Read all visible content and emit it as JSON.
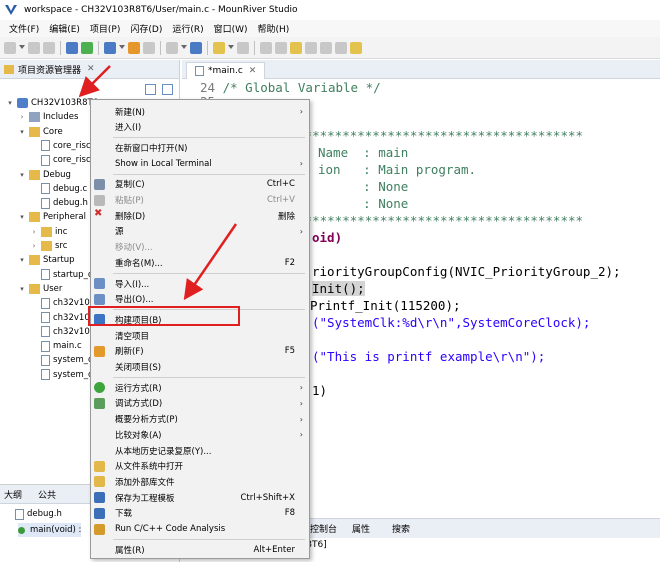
{
  "window": {
    "title": "workspace - CH32V103R8T6/User/main.c - MounRiver Studio"
  },
  "menubar": [
    "文件(F)",
    "编辑(E)",
    "项目(P)",
    "闪存(D)",
    "运行(R)",
    "窗口(W)",
    "帮助(H)"
  ],
  "explorer": {
    "title": "项目资源管理器",
    "close": "✕",
    "tree": [
      {
        "label": "CH32V103R8T6",
        "level": 0,
        "type": "proj",
        "expanded": true
      },
      {
        "label": "Includes",
        "level": 1,
        "type": "inc",
        "expanded": false
      },
      {
        "label": "Core",
        "level": 1,
        "type": "fold",
        "expanded": true
      },
      {
        "label": "core_risc",
        "level": 2,
        "type": "file"
      },
      {
        "label": "core_risc",
        "level": 2,
        "type": "file"
      },
      {
        "label": "Debug",
        "level": 1,
        "type": "fold",
        "expanded": true
      },
      {
        "label": "debug.c",
        "level": 2,
        "type": "file"
      },
      {
        "label": "debug.h",
        "level": 2,
        "type": "file"
      },
      {
        "label": "Peripheral",
        "level": 1,
        "type": "fold",
        "expanded": true
      },
      {
        "label": "inc",
        "level": 2,
        "type": "fold",
        "expanded": false
      },
      {
        "label": "src",
        "level": 2,
        "type": "fold",
        "expanded": false
      },
      {
        "label": "Startup",
        "level": 1,
        "type": "fold",
        "expanded": true
      },
      {
        "label": "startup_c",
        "level": 2,
        "type": "file"
      },
      {
        "label": "User",
        "level": 1,
        "type": "fold",
        "expanded": true
      },
      {
        "label": "ch32v10",
        "level": 2,
        "type": "file"
      },
      {
        "label": "ch32v10",
        "level": 2,
        "type": "file"
      },
      {
        "label": "ch32v10",
        "level": 2,
        "type": "file"
      },
      {
        "label": "main.c",
        "level": 2,
        "type": "file"
      },
      {
        "label": "system_c",
        "level": 2,
        "type": "file"
      },
      {
        "label": "system_c",
        "level": 2,
        "type": "file"
      }
    ]
  },
  "editor": {
    "tab": "*main.c",
    "tab_close": "✕",
    "lines": [
      {
        "num": "24",
        "text": "/* Global Variable */"
      },
      {
        "num": "25",
        "text": ""
      },
      {
        "num": "",
        "text": "****************************************"
      },
      {
        "num": "",
        "text": "Name  : main"
      },
      {
        "num": "",
        "text": "ion   : Main program."
      },
      {
        "num": "",
        "text": "      : None"
      },
      {
        "num": "",
        "text": "      : None"
      },
      {
        "num": "",
        "text": "****************************************"
      },
      {
        "num": "",
        "text": "oid)"
      },
      {
        "num": "",
        "text": "riorityGroupConfig(NVIC_PriorityGroup_2);"
      },
      {
        "num": "",
        "text": "Init();"
      },
      {
        "num": "",
        "text": "Printf_Init(115200);"
      },
      {
        "num": "",
        "text": "(\"SystemClk:%d\\r\\n\",SystemCoreClock);"
      },
      {
        "num": "",
        "text": "(\"This is printf example\\r\\n\");"
      },
      {
        "num": "",
        "text": "1)"
      }
    ]
  },
  "outline": {
    "tabs": [
      "大纲",
      "公共"
    ],
    "rows": [
      "debug.h",
      "main(void) :"
    ]
  },
  "console": {
    "tabs": [
      "控制台",
      "属性",
      "搜索"
    ],
    "text": "R8T6]"
  },
  "context_menu": [
    {
      "label": "新建(N)",
      "shortcut": "",
      "sub": true,
      "icon": ""
    },
    {
      "label": "进入(I)",
      "shortcut": "",
      "sub": false,
      "icon": ""
    },
    {
      "sep": true
    },
    {
      "label": "在新窗口中打开(N)",
      "shortcut": "",
      "sub": false,
      "icon": ""
    },
    {
      "label": "Show in Local Terminal",
      "shortcut": "",
      "sub": true,
      "icon": ""
    },
    {
      "sep": true
    },
    {
      "label": "复制(C)",
      "shortcut": "Ctrl+C",
      "sub": false,
      "icon": "copy"
    },
    {
      "label": "粘贴(P)",
      "shortcut": "Ctrl+V",
      "sub": false,
      "icon": "paste",
      "disabled": true
    },
    {
      "label": "删除(D)",
      "shortcut": "删除",
      "sub": false,
      "icon": "delete"
    },
    {
      "label": "源",
      "shortcut": "",
      "sub": true,
      "icon": ""
    },
    {
      "label": "移动(V)...",
      "shortcut": "",
      "sub": false,
      "icon": "",
      "disabled": true
    },
    {
      "label": "重命名(M)...",
      "shortcut": "F2",
      "sub": false,
      "icon": ""
    },
    {
      "sep": true
    },
    {
      "label": "导入(I)...",
      "shortcut": "",
      "sub": false,
      "icon": "import"
    },
    {
      "label": "导出(O)...",
      "shortcut": "",
      "sub": false,
      "icon": "export"
    },
    {
      "sep": true
    },
    {
      "label": "构建项目(B)",
      "shortcut": "",
      "sub": false,
      "icon": "build"
    },
    {
      "label": "清空项目",
      "shortcut": "",
      "sub": false,
      "icon": ""
    },
    {
      "label": "刷新(F)",
      "shortcut": "F5",
      "sub": false,
      "icon": "refresh"
    },
    {
      "label": "关闭项目(S)",
      "shortcut": "",
      "sub": false,
      "icon": ""
    },
    {
      "sep": true
    },
    {
      "label": "运行方式(R)",
      "shortcut": "",
      "sub": true,
      "icon": "run"
    },
    {
      "label": "调试方式(D)",
      "shortcut": "",
      "sub": true,
      "icon": "debug"
    },
    {
      "label": "概要分析方式(P)",
      "shortcut": "",
      "sub": true,
      "icon": ""
    },
    {
      "label": "比较对象(A)",
      "shortcut": "",
      "sub": true,
      "icon": ""
    },
    {
      "label": "从本地历史记录复原(Y)...",
      "shortcut": "",
      "sub": false,
      "icon": ""
    },
    {
      "label": "从文件系统中打开",
      "shortcut": "",
      "sub": false,
      "icon": "folder"
    },
    {
      "label": "添加外部库文件",
      "shortcut": "",
      "sub": false,
      "icon": "folder"
    },
    {
      "label": "保存为工程模板",
      "shortcut": "Ctrl+Shift+X",
      "sub": false,
      "icon": "save"
    },
    {
      "label": "下载",
      "shortcut": "F8",
      "sub": false,
      "icon": "download"
    },
    {
      "label": "Run C/C++ Code Analysis",
      "shortcut": "",
      "sub": false,
      "icon": "analysis"
    },
    {
      "sep": true
    },
    {
      "label": "属性(R)",
      "shortcut": "Alt+Enter",
      "sub": false,
      "icon": ""
    }
  ],
  "colors": {
    "highlight_box": "#e02020",
    "arrow": "#e02020"
  }
}
